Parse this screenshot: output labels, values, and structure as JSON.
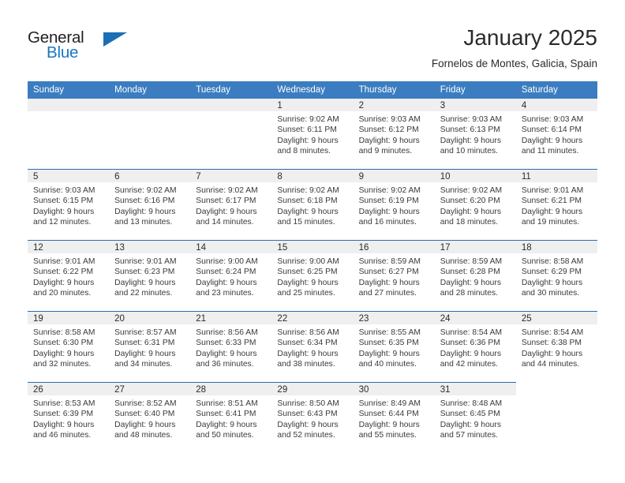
{
  "brand": {
    "word_one": "General",
    "word_two": "Blue",
    "triangle_icon": "triangle-icon",
    "primary_color": "#1877c4",
    "text_color": "#231f20"
  },
  "header": {
    "month_title": "January 2025",
    "location": "Fornelos de Montes, Galicia, Spain"
  },
  "theme": {
    "header_bg": "#3b7dc0",
    "row_divider": "#2e6da4",
    "daynum_band_bg": "#efefef",
    "body_text": "#3a3a3a"
  },
  "calendar": {
    "weekday_headers": [
      "Sunday",
      "Monday",
      "Tuesday",
      "Wednesday",
      "Thursday",
      "Friday",
      "Saturday"
    ],
    "weeks": [
      [
        {
          "blank": true
        },
        {
          "blank": true
        },
        {
          "blank": true
        },
        {
          "day": "1",
          "sunrise": "Sunrise: 9:02 AM",
          "sunset": "Sunset: 6:11 PM",
          "daylight": "Daylight: 9 hours and 8 minutes."
        },
        {
          "day": "2",
          "sunrise": "Sunrise: 9:03 AM",
          "sunset": "Sunset: 6:12 PM",
          "daylight": "Daylight: 9 hours and 9 minutes."
        },
        {
          "day": "3",
          "sunrise": "Sunrise: 9:03 AM",
          "sunset": "Sunset: 6:13 PM",
          "daylight": "Daylight: 9 hours and 10 minutes."
        },
        {
          "day": "4",
          "sunrise": "Sunrise: 9:03 AM",
          "sunset": "Sunset: 6:14 PM",
          "daylight": "Daylight: 9 hours and 11 minutes."
        }
      ],
      [
        {
          "day": "5",
          "sunrise": "Sunrise: 9:03 AM",
          "sunset": "Sunset: 6:15 PM",
          "daylight": "Daylight: 9 hours and 12 minutes."
        },
        {
          "day": "6",
          "sunrise": "Sunrise: 9:02 AM",
          "sunset": "Sunset: 6:16 PM",
          "daylight": "Daylight: 9 hours and 13 minutes."
        },
        {
          "day": "7",
          "sunrise": "Sunrise: 9:02 AM",
          "sunset": "Sunset: 6:17 PM",
          "daylight": "Daylight: 9 hours and 14 minutes."
        },
        {
          "day": "8",
          "sunrise": "Sunrise: 9:02 AM",
          "sunset": "Sunset: 6:18 PM",
          "daylight": "Daylight: 9 hours and 15 minutes."
        },
        {
          "day": "9",
          "sunrise": "Sunrise: 9:02 AM",
          "sunset": "Sunset: 6:19 PM",
          "daylight": "Daylight: 9 hours and 16 minutes."
        },
        {
          "day": "10",
          "sunrise": "Sunrise: 9:02 AM",
          "sunset": "Sunset: 6:20 PM",
          "daylight": "Daylight: 9 hours and 18 minutes."
        },
        {
          "day": "11",
          "sunrise": "Sunrise: 9:01 AM",
          "sunset": "Sunset: 6:21 PM",
          "daylight": "Daylight: 9 hours and 19 minutes."
        }
      ],
      [
        {
          "day": "12",
          "sunrise": "Sunrise: 9:01 AM",
          "sunset": "Sunset: 6:22 PM",
          "daylight": "Daylight: 9 hours and 20 minutes."
        },
        {
          "day": "13",
          "sunrise": "Sunrise: 9:01 AM",
          "sunset": "Sunset: 6:23 PM",
          "daylight": "Daylight: 9 hours and 22 minutes."
        },
        {
          "day": "14",
          "sunrise": "Sunrise: 9:00 AM",
          "sunset": "Sunset: 6:24 PM",
          "daylight": "Daylight: 9 hours and 23 minutes."
        },
        {
          "day": "15",
          "sunrise": "Sunrise: 9:00 AM",
          "sunset": "Sunset: 6:25 PM",
          "daylight": "Daylight: 9 hours and 25 minutes."
        },
        {
          "day": "16",
          "sunrise": "Sunrise: 8:59 AM",
          "sunset": "Sunset: 6:27 PM",
          "daylight": "Daylight: 9 hours and 27 minutes."
        },
        {
          "day": "17",
          "sunrise": "Sunrise: 8:59 AM",
          "sunset": "Sunset: 6:28 PM",
          "daylight": "Daylight: 9 hours and 28 minutes."
        },
        {
          "day": "18",
          "sunrise": "Sunrise: 8:58 AM",
          "sunset": "Sunset: 6:29 PM",
          "daylight": "Daylight: 9 hours and 30 minutes."
        }
      ],
      [
        {
          "day": "19",
          "sunrise": "Sunrise: 8:58 AM",
          "sunset": "Sunset: 6:30 PM",
          "daylight": "Daylight: 9 hours and 32 minutes."
        },
        {
          "day": "20",
          "sunrise": "Sunrise: 8:57 AM",
          "sunset": "Sunset: 6:31 PM",
          "daylight": "Daylight: 9 hours and 34 minutes."
        },
        {
          "day": "21",
          "sunrise": "Sunrise: 8:56 AM",
          "sunset": "Sunset: 6:33 PM",
          "daylight": "Daylight: 9 hours and 36 minutes."
        },
        {
          "day": "22",
          "sunrise": "Sunrise: 8:56 AM",
          "sunset": "Sunset: 6:34 PM",
          "daylight": "Daylight: 9 hours and 38 minutes."
        },
        {
          "day": "23",
          "sunrise": "Sunrise: 8:55 AM",
          "sunset": "Sunset: 6:35 PM",
          "daylight": "Daylight: 9 hours and 40 minutes."
        },
        {
          "day": "24",
          "sunrise": "Sunrise: 8:54 AM",
          "sunset": "Sunset: 6:36 PM",
          "daylight": "Daylight: 9 hours and 42 minutes."
        },
        {
          "day": "25",
          "sunrise": "Sunrise: 8:54 AM",
          "sunset": "Sunset: 6:38 PM",
          "daylight": "Daylight: 9 hours and 44 minutes."
        }
      ],
      [
        {
          "day": "26",
          "sunrise": "Sunrise: 8:53 AM",
          "sunset": "Sunset: 6:39 PM",
          "daylight": "Daylight: 9 hours and 46 minutes."
        },
        {
          "day": "27",
          "sunrise": "Sunrise: 8:52 AM",
          "sunset": "Sunset: 6:40 PM",
          "daylight": "Daylight: 9 hours and 48 minutes."
        },
        {
          "day": "28",
          "sunrise": "Sunrise: 8:51 AM",
          "sunset": "Sunset: 6:41 PM",
          "daylight": "Daylight: 9 hours and 50 minutes."
        },
        {
          "day": "29",
          "sunrise": "Sunrise: 8:50 AM",
          "sunset": "Sunset: 6:43 PM",
          "daylight": "Daylight: 9 hours and 52 minutes."
        },
        {
          "day": "30",
          "sunrise": "Sunrise: 8:49 AM",
          "sunset": "Sunset: 6:44 PM",
          "daylight": "Daylight: 9 hours and 55 minutes."
        },
        {
          "day": "31",
          "sunrise": "Sunrise: 8:48 AM",
          "sunset": "Sunset: 6:45 PM",
          "daylight": "Daylight: 9 hours and 57 minutes."
        },
        {
          "blank": true,
          "trailing": true
        }
      ]
    ]
  }
}
